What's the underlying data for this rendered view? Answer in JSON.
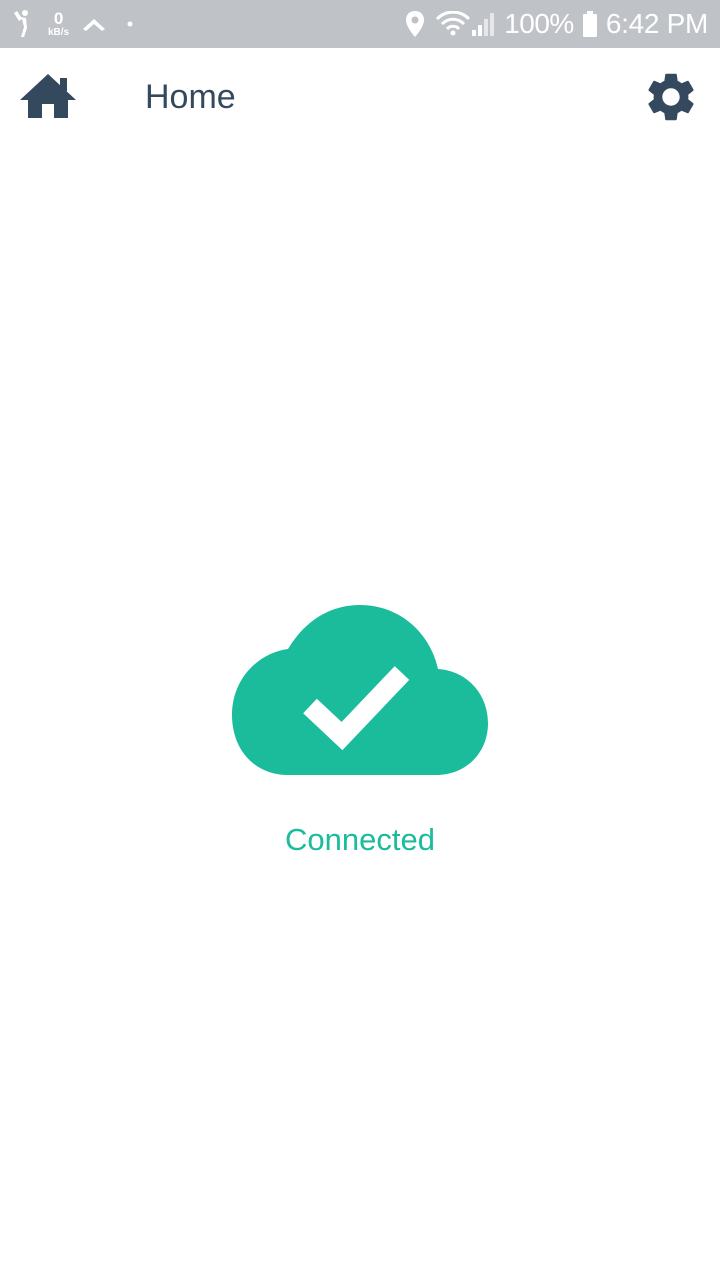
{
  "status_bar": {
    "speed_value": "0",
    "speed_unit": "kB/s",
    "battery_percent": "100%",
    "time": "6:42 PM"
  },
  "app_bar": {
    "title": "Home",
    "home_icon": "home-icon",
    "settings_icon": "gear-icon"
  },
  "connection": {
    "status_label": "Connected",
    "icon": "cloud-check-icon"
  },
  "colors": {
    "accent": "#1abc9c",
    "dark": "#34495e",
    "status_bar_bg": "#bfc2c6"
  }
}
